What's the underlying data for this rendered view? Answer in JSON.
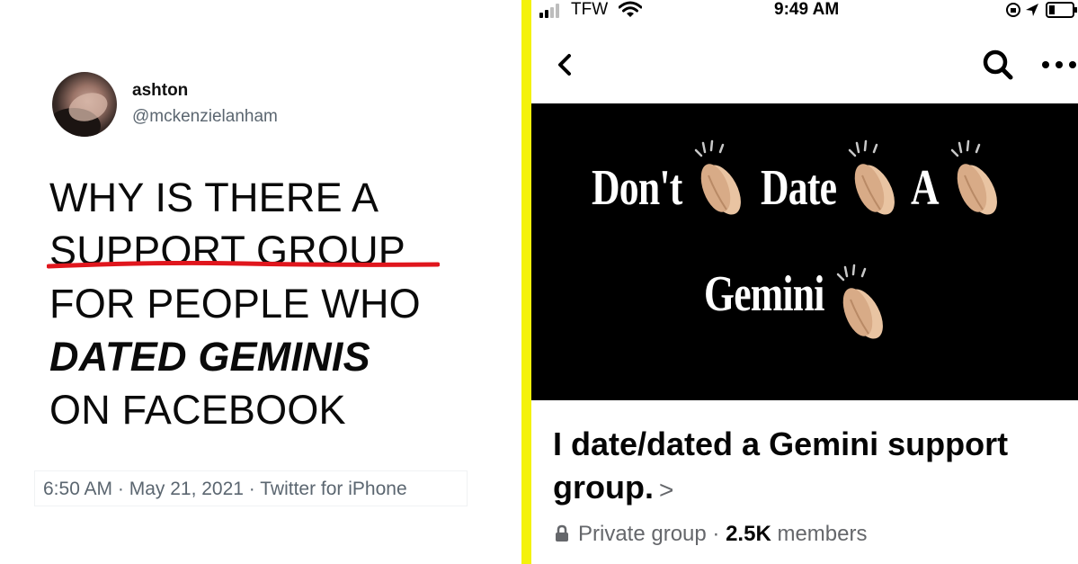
{
  "tweet": {
    "display_name": "ashton",
    "handle": "@mckenzielanham",
    "lines": [
      "WHY IS THERE A",
      "SUPPORT GROUP",
      "FOR PEOPLE WHO",
      "DATED GEMINIS",
      "ON FACEBOOK"
    ],
    "meta": "6:50 AM · May 21, 2021 · Twitter for iPhone"
  },
  "status_bar": {
    "carrier": "TFW",
    "time": "9:49 AM"
  },
  "cover": {
    "words": [
      "Don't",
      "Date",
      "A",
      "Gemini"
    ]
  },
  "group": {
    "title_line1": "I date/dated a Gemini support",
    "title_line2": "group.",
    "chevron": ">",
    "privacy": "Private group",
    "separator": " · ",
    "member_count": "2.5K",
    "members_label": " members"
  },
  "colors": {
    "divider": "#f4f20a",
    "underline": "#e0161d",
    "secondary_text": "#65676b"
  }
}
